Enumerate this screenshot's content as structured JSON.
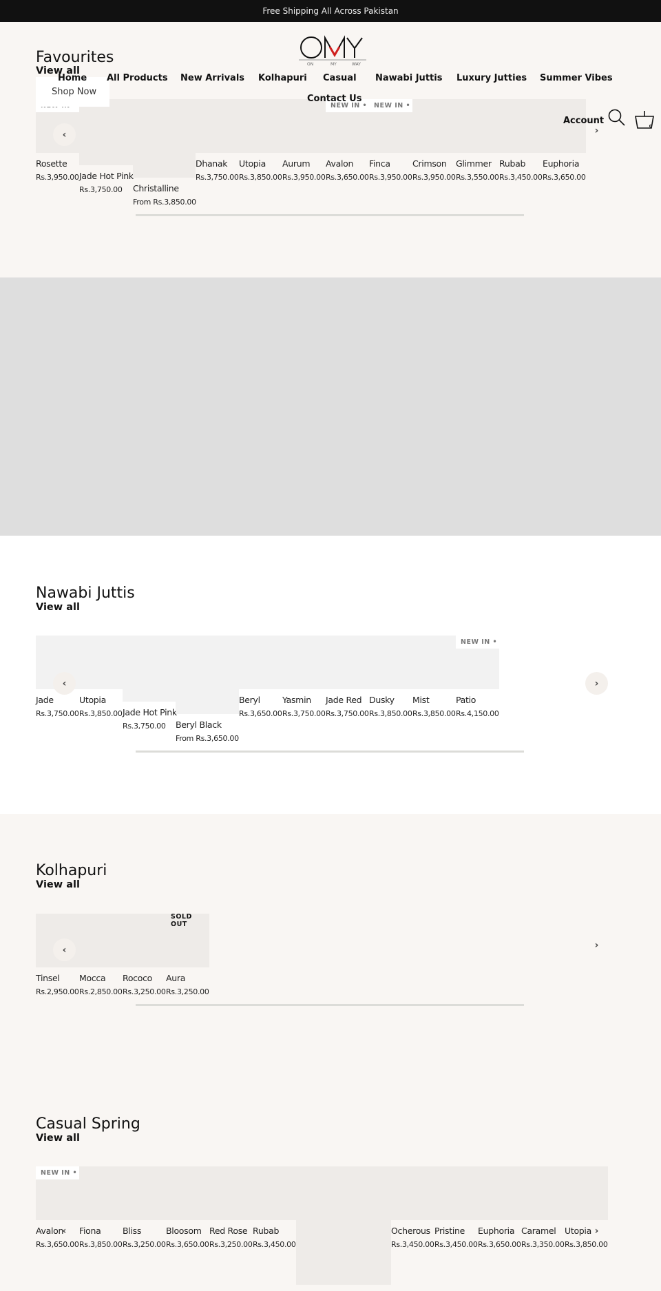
{
  "announcement": "Free Shipping All Across Pakistan",
  "logo": {
    "text": "OMY",
    "tagline": [
      "ON",
      "MY",
      "WAY"
    ],
    "accent": "#d0201f"
  },
  "nav": {
    "items": [
      "Home",
      "All Products",
      "New Arrivals",
      "Kolhapuri",
      "Casual",
      "Nawabi Juttis",
      "Luxury Jutties",
      "Summer Vibes",
      "Contact Us"
    ],
    "account": "Account",
    "search_icon": "search-icon",
    "cart_icon": "basket-icon"
  },
  "hero": {
    "shop_now": "Shop Now"
  },
  "badges": {
    "new_in": "NEW IN",
    "sold_out": "SOLD OUT"
  },
  "sections": [
    {
      "title": "Favourites",
      "view_all": "View all",
      "products": [
        {
          "name": "Rosette",
          "price": "Rs.3,950.00",
          "badge": "NEW IN"
        },
        {
          "name": "Jade Hot Pink",
          "price": "Rs.3,750.00"
        },
        {
          "name": "Christalline",
          "price": "From Rs.3,850.00"
        },
        {
          "name": "Dhanak",
          "price": "Rs.3,750.00"
        },
        {
          "name": "Utopia",
          "price": "Rs.3,850.00"
        },
        {
          "name": "Aurum",
          "price": "Rs.3,950.00"
        },
        {
          "name": "Avalon",
          "price": "Rs.3,650.00",
          "badge": "NEW IN"
        },
        {
          "name": "Finca",
          "price": "Rs.3,950.00",
          "badge": "NEW IN"
        },
        {
          "name": "Crimson",
          "price": "Rs.3,950.00"
        },
        {
          "name": "Glimmer",
          "price": "Rs.3,550.00"
        },
        {
          "name": "Rubab",
          "price": "Rs.3,450.00"
        },
        {
          "name": "Euphoria",
          "price": "Rs.3,650.00"
        }
      ]
    },
    {
      "title": "Nawabi Juttis",
      "view_all": "View all",
      "products": [
        {
          "name": "Jade",
          "price": "Rs.3,750.00"
        },
        {
          "name": "Utopia",
          "price": "Rs.3,850.00"
        },
        {
          "name": "Jade Hot Pink",
          "price": "Rs.3,750.00"
        },
        {
          "name": "Beryl Black",
          "price": "From Rs.3,650.00"
        },
        {
          "name": "Beryl",
          "price": "Rs.3,650.00"
        },
        {
          "name": "Yasmin",
          "price": "Rs.3,750.00"
        },
        {
          "name": "Jade Red",
          "price": "Rs.3,750.00"
        },
        {
          "name": "Dusky",
          "price": "Rs.3,850.00"
        },
        {
          "name": "Mist",
          "price": "Rs.3,850.00"
        },
        {
          "name": "Patio",
          "price": "Rs.4,150.00",
          "badge": "NEW IN"
        }
      ]
    },
    {
      "title": "Kolhapuri",
      "view_all": "View all",
      "products": [
        {
          "name": "Tinsel",
          "price": "Rs.2,950.00"
        },
        {
          "name": "Mocca",
          "price": "Rs.2,850.00"
        },
        {
          "name": "Rococo",
          "price": "Rs.3,250.00"
        },
        {
          "name": "Aura",
          "price": "Rs.3,250.00",
          "badge": "SOLD OUT"
        }
      ]
    },
    {
      "title": "Casual Spring",
      "view_all": "View all",
      "products": [
        {
          "name": "Avalon",
          "price": "Rs.3,650.00",
          "badge": "NEW IN"
        },
        {
          "name": "Fiona",
          "price": "Rs.3,850.00"
        },
        {
          "name": "Bliss",
          "price": "Rs.3,250.00"
        },
        {
          "name": "Bloosom",
          "price": "Rs.3,650.00"
        },
        {
          "name": "Red Rose",
          "price": "Rs.3,250.00"
        },
        {
          "name": "Rubab",
          "price": "Rs.3,450.00"
        },
        {
          "name": "",
          "price": ""
        },
        {
          "name": "Ocherous",
          "price": "Rs.3,450.00"
        },
        {
          "name": "Pristine",
          "price": "Rs.3,450.00"
        },
        {
          "name": "Euphoria",
          "price": "Rs.3,650.00"
        },
        {
          "name": "Caramel",
          "price": "Rs.3,350.00"
        },
        {
          "name": "Utopia",
          "price": "Rs.3,850.00"
        }
      ]
    }
  ],
  "colors": {
    "bg": "#f9f6f3",
    "banner": "#dedede",
    "placeholder": "#eeebe8"
  }
}
